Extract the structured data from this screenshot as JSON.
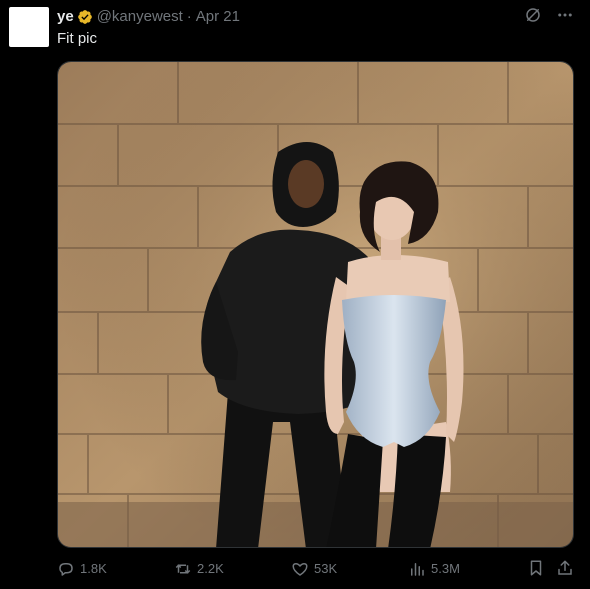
{
  "author": {
    "display_name": "ye",
    "handle": "@kanyewest",
    "separator": "·",
    "date": "Apr 21"
  },
  "tweet": {
    "text": "Fit pic"
  },
  "media": {
    "description_icon": "photo"
  },
  "actions": {
    "replies": "1.8K",
    "reposts": "2.2K",
    "likes": "53K",
    "views": "5.3M"
  },
  "colors": {
    "background": "#000000",
    "text": "#e7e9ea",
    "muted": "#71767b",
    "verified": "#e8b829"
  }
}
